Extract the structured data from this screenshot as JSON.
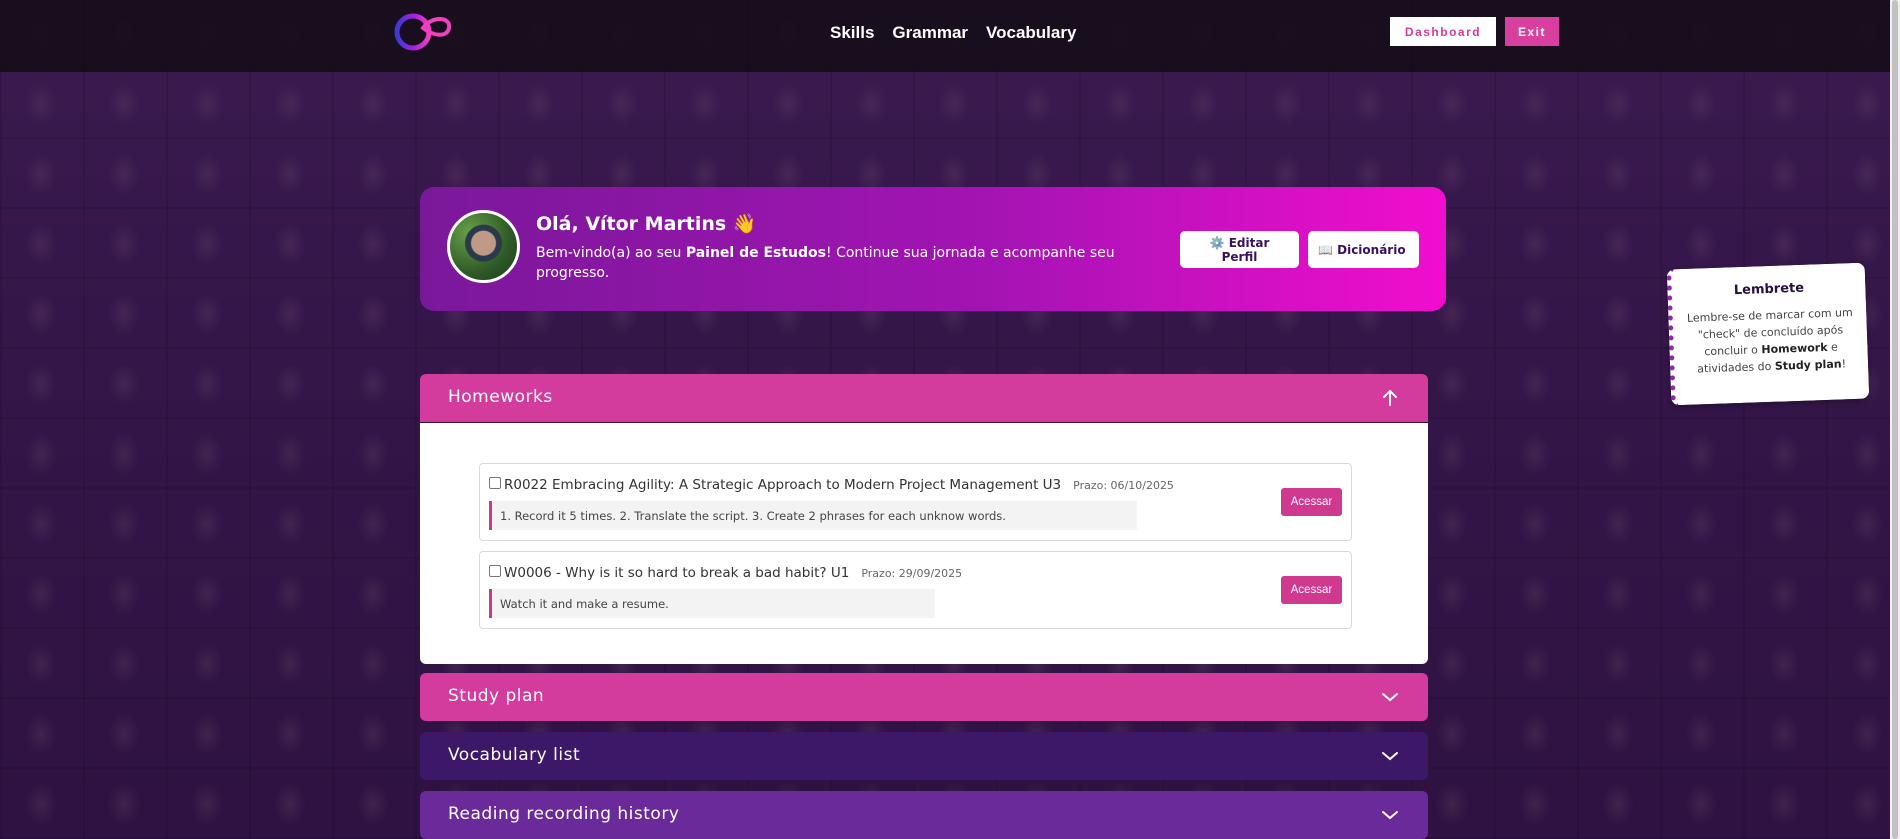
{
  "nav": {
    "links": [
      "Skills",
      "Grammar",
      "Vocabulary"
    ],
    "dashboard_label": "Dashboard",
    "exit_label": "Exit"
  },
  "welcome": {
    "greeting": "Olá, Vítor Martins 👋",
    "text_prefix": "Bem-vindo(a) ao seu ",
    "text_bold": "Painel de Estudos",
    "text_suffix": "! Continue sua jornada e acompanhe seu progresso.",
    "edit_profile_label": "⚙️ Editar Perfil",
    "dictionary_label": "📖 Dicionário"
  },
  "reminder": {
    "title": "Lembrete",
    "text_1": "Lembre-se de marcar com um \"check\" de concluído após concluir o ",
    "bold_1": "Homework",
    "text_2": " e atividades do ",
    "bold_2": "Study plan",
    "text_3": "!"
  },
  "sections": {
    "homeworks": "Homeworks",
    "study_plan": "Study plan",
    "vocabulary_list": "Vocabulary list",
    "reading_history": "Reading recording history"
  },
  "homeworks": [
    {
      "title": "R0022 Embracing Agility: A Strategic Approach to Modern Project Management U3",
      "due": "Prazo: 06/10/2025",
      "description": "1. Record it 5 times. 2. Translate the script. 3. Create 2 phrases for each unknow words.",
      "action": "Acessar"
    },
    {
      "title": "W0006 - Why is it so hard to break a bad habit? U1",
      "due": "Prazo: 29/09/2025",
      "description": "Watch it and make a resume.",
      "action": "Acessar"
    }
  ],
  "colors": {
    "accent_pink": "#d33c9c",
    "dark_purple": "#3d1868",
    "purple": "#6a2a9a"
  }
}
